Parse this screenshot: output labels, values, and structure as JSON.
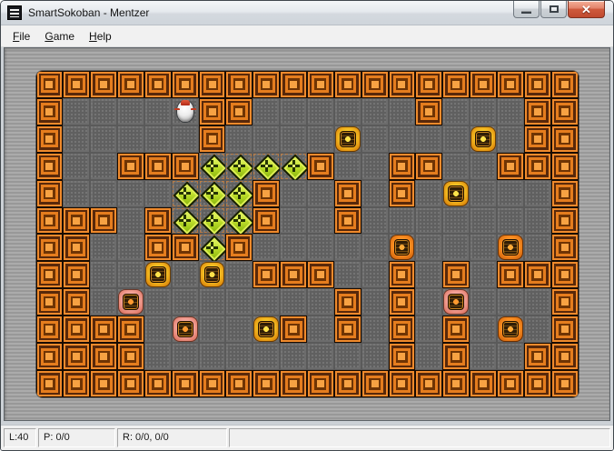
{
  "window": {
    "title": "SmartSokoban - Mentzer",
    "icon": "app-icon",
    "controls": {
      "minimize": "minimize-icon",
      "maximize": "maximize-icon",
      "close": "close-icon"
    }
  },
  "menu": {
    "items": [
      {
        "label": "File"
      },
      {
        "label": "Game"
      },
      {
        "label": "Help"
      }
    ]
  },
  "game": {
    "board": {
      "columns": 20,
      "rows_count": 12,
      "legend": {
        "#": "wall",
        ".": "floor",
        "G": "goal",
        "P": "player",
        "Y": "box-yellow",
        "K": "box-pink",
        "O": "box-orange"
      },
      "rows": [
        "####################",
        "#....P##......#...##",
        "#.....#....Y....Y.##",
        "#..###GGGG#..##..###",
        "#....GGG#..#.#.Y...#",
        "###.#GGG#..#.......#",
        "##..##G#.....O...O.#",
        "##..Y.Y.###..#.#.###",
        "##.K.......#.#.K...#",
        "####.K..Y#.#.#.#.O.#",
        "####.........#.#..##",
        "####################"
      ]
    },
    "palette": {
      "wall_orange": "#e57d1e",
      "floor_gray": "#6c6c6c",
      "goal_green": "#bede2c",
      "box_yellow": "#f7c526",
      "box_pink": "#f3a297",
      "box_orange": "#fb8f22",
      "background_stripes": "#a0a0a0"
    }
  },
  "status": {
    "level": "L:40",
    "pushes": "P: 0/0",
    "rating": "R: 0/0, 0/0",
    "extra": ""
  }
}
